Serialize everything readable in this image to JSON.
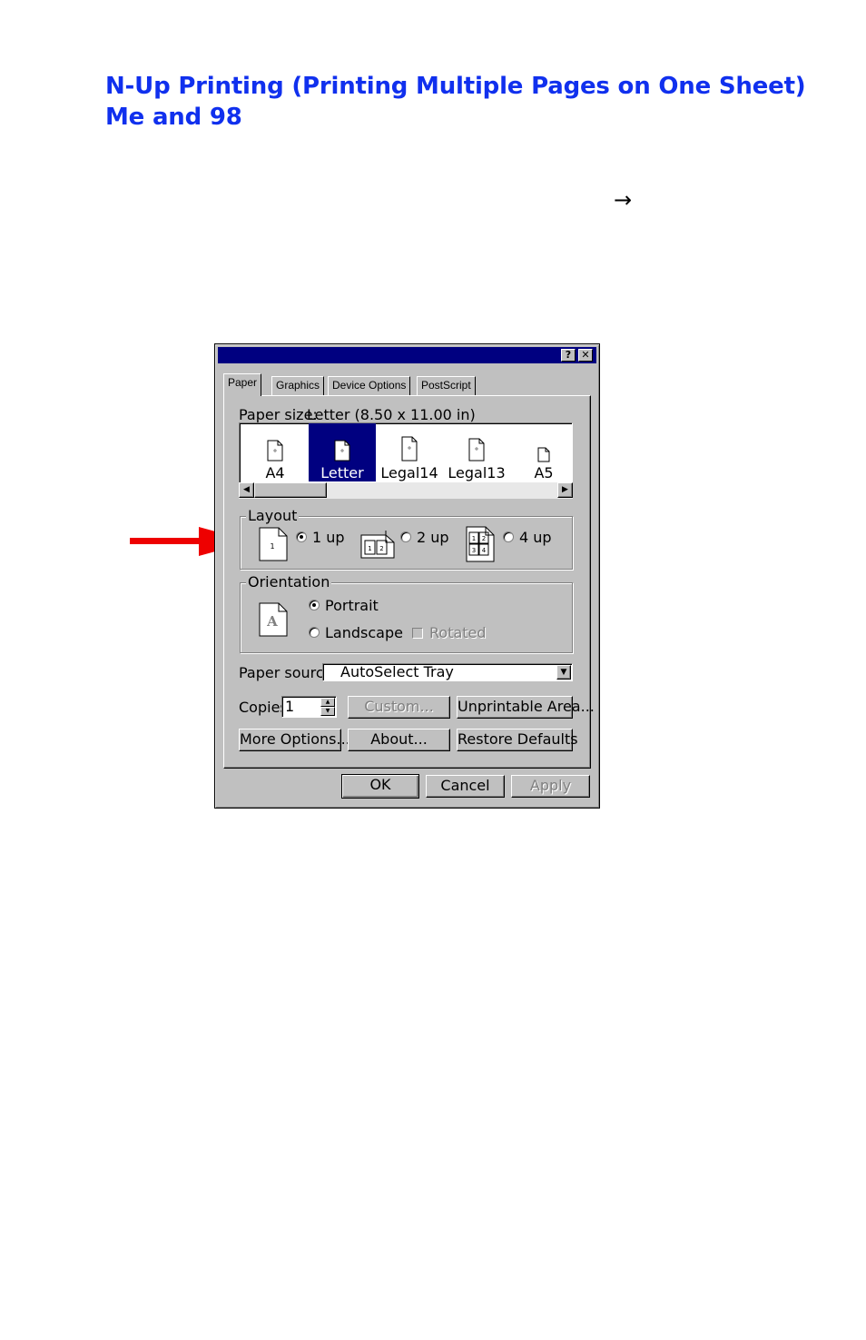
{
  "document": {
    "title_line1": "N-Up Printing (Printing Multiple Pages on One Sheet)",
    "title_line2": "Me and 98",
    "arrow_glyph": "→"
  },
  "colors": {
    "heading": "#1030ee",
    "pointer_arrow": "#ee0000",
    "titlebar": "#000080",
    "dialog_face": "#c0c0c0"
  },
  "dialog": {
    "help_button": "?",
    "close_button": "✕",
    "tabs": [
      "Paper",
      "Graphics",
      "Device Options",
      "PostScript"
    ],
    "active_tab": "Paper",
    "paper_size_label": "Paper size:",
    "paper_size_value": "Letter (8.50 x 11.00 in)",
    "paper_items": [
      "A4",
      "Letter",
      "Legal14",
      "Legal13",
      "A5"
    ],
    "selected_paper": "Letter",
    "layout": {
      "group_label": "Layout",
      "options": [
        {
          "label": "1 up",
          "icon_text": "1",
          "selected": true
        },
        {
          "label": "2 up",
          "icon_text": "1 2",
          "selected": false
        },
        {
          "label": "4 up",
          "icon_text": "1 2 3 4",
          "selected": false
        }
      ],
      "icon_digits": {
        "one": "1",
        "two_a": "1",
        "two_b": "2",
        "four_a": "1",
        "four_b": "2",
        "four_c": "3",
        "four_d": "4"
      }
    },
    "orientation": {
      "group_label": "Orientation",
      "icon_letter": "A",
      "portrait": "Portrait",
      "landscape": "Landscape",
      "rotated": "Rotated",
      "selected": "Portrait"
    },
    "paper_source_label": "Paper source:",
    "paper_source_value": "AutoSelect Tray",
    "copies_label": "Copies:",
    "copies_value": "1",
    "buttons": {
      "custom": "Custom...",
      "unprintable_area": "Unprintable Area...",
      "more_options": "More Options...",
      "about": "About...",
      "restore_defaults": "Restore Defaults",
      "ok": "OK",
      "cancel": "Cancel",
      "apply": "Apply"
    }
  }
}
